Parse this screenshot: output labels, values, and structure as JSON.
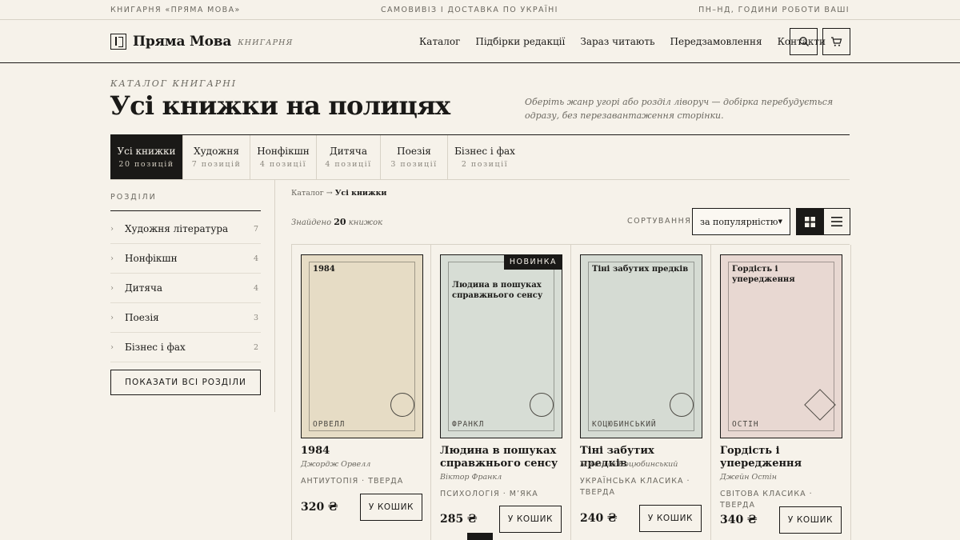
{
  "topbar": {
    "left": "КНИГАРНЯ «ПРЯМА МОВА»",
    "center": "САМОВИВІЗ І ДОСТАВКА ПО УКРАЇНІ",
    "right": "ПН–НД, ГОДИНИ РОБОТИ ВАШІ"
  },
  "header": {
    "logo_name": "Пряма Мова",
    "logo_sub": "КНИГАРНЯ",
    "logo_icon": "book-mark-icon",
    "nav": [
      "Каталог",
      "Підбірки редакції",
      "Зараз читають",
      "Передзамовлення",
      "Контакти"
    ],
    "search_icon": "search-icon",
    "cart_icon": "cart-icon"
  },
  "page": {
    "eyebrow": "КАТАЛОГ КНИГАРНІ",
    "title": "Усі книжки на полицях",
    "hint": "Оберіть жанр угорі або розділ ліворуч — добірка перебудується одразу, без перезавантаження сторінки."
  },
  "tabs": [
    {
      "label": "Усі книжки",
      "count": "20 позицій",
      "active": true
    },
    {
      "label": "Художня",
      "count": "7 позицій",
      "active": false
    },
    {
      "label": "Нонфікшн",
      "count": "4 позиції",
      "active": false
    },
    {
      "label": "Дитяча",
      "count": "4 позиції",
      "active": false
    },
    {
      "label": "Поезія",
      "count": "3 позиції",
      "active": false
    },
    {
      "label": "Бізнес і фах",
      "count": "2 позиції",
      "active": false
    }
  ],
  "sidebar": {
    "title": "РОЗДІЛИ",
    "items": [
      {
        "label": "Художня література",
        "count": "7"
      },
      {
        "label": "Нонфікшн",
        "count": "4"
      },
      {
        "label": "Дитяча",
        "count": "4"
      },
      {
        "label": "Поезія",
        "count": "3"
      },
      {
        "label": "Бізнес і фах",
        "count": "2"
      }
    ],
    "show_all": "ПОКАЗАТИ ВСІ РОЗДІЛИ"
  },
  "toolbar": {
    "breadcrumb_root": "Каталог",
    "breadcrumb_arrow": "→",
    "breadcrumb_current": "Усі книжки",
    "found_prefix": "Знайдено",
    "found_count": "20",
    "found_suffix": "книжок",
    "sort_label": "СОРТУВАННЯ",
    "sort_value": "за популярністю",
    "grid_icon": "grid-view-icon",
    "list_icon": "list-view-icon"
  },
  "products": [
    {
      "cover_title": "1984",
      "cover_author": "ОРВЕЛЛ",
      "cover_color": "#e6dcc5",
      "badge": "",
      "title": "1984",
      "author": "Джордж Орвелл",
      "meta": "АНТИУТОПІЯ · ТВЕРДА",
      "price": "320 ₴",
      "buy": "У КОШИК",
      "shape": "circle"
    },
    {
      "cover_title": "Людина в пошуках справжнього сенсу",
      "cover_author": "ФРАНКЛ",
      "cover_color": "#d7ddd5",
      "badge": "НОВИНКА",
      "title": "Людина в пошуках справжнього сенсу",
      "author": "Віктор Франкл",
      "meta": "ПСИХОЛОГІЯ · М’ЯКА",
      "price": "285 ₴",
      "buy": "У КОШИК",
      "shape": "circle"
    },
    {
      "cover_title": "Тіні забутих предків",
      "cover_author": "КОЦЮБИНСЬКИЙ",
      "cover_color": "#d5dbd3",
      "badge": "",
      "title": "Тіні забутих предків",
      "author": "Михайло Коцюбинський",
      "meta": "УКРАЇНСЬКА КЛАСИКА · ТВЕРДА",
      "price": "240 ₴",
      "buy": "У КОШИК",
      "shape": "circle"
    },
    {
      "cover_title": "Гордість і упередження",
      "cover_author": "ОСТІН",
      "cover_color": "#e8d8d2",
      "badge": "",
      "title": "Гордість і упередження",
      "author": "Джейн Остін",
      "meta": "СВІТОВА КЛАСИКА · ТВЕРДА",
      "price": "340 ₴",
      "buy": "У КОШИК",
      "shape": "diamond"
    }
  ]
}
